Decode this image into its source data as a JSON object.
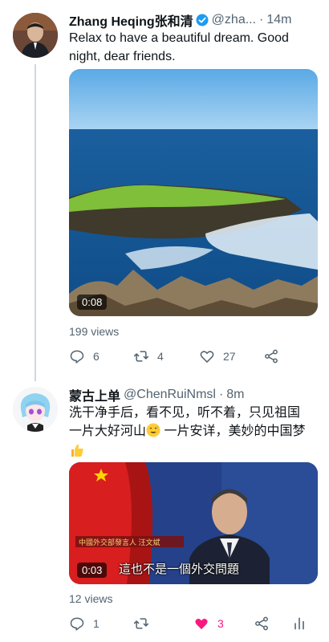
{
  "tweets": [
    {
      "name": "Zhang Heqing张和清",
      "handle": "@zha...",
      "separator": "·",
      "time": "14m",
      "text": "Relax to have a beautiful dream.  Good night, dear friends.",
      "video_duration": "0:08",
      "views": "199 views",
      "replies": "6",
      "retweets": "4",
      "likes": "27"
    },
    {
      "name": "蒙古上单",
      "handle": "@ChenRuiNmsl",
      "separator": "·",
      "time": "8m",
      "text_line1": "洗干净手后，看不见，听不着，只见祖国",
      "text_line2_a": "一片大好河山",
      "text_line2_b": " 一片安详，美妙的中国梦",
      "video_duration": "0:03",
      "video_banner": "中國外交部發言人 汪文斌",
      "video_subtitle": "這也不是一個外交問題",
      "views": "12 views",
      "replies": "1",
      "retweets": "",
      "likes": "3"
    }
  ],
  "colors": {
    "like_active": "#f91880",
    "verified": "#1d9bf0",
    "muted": "#536471"
  }
}
